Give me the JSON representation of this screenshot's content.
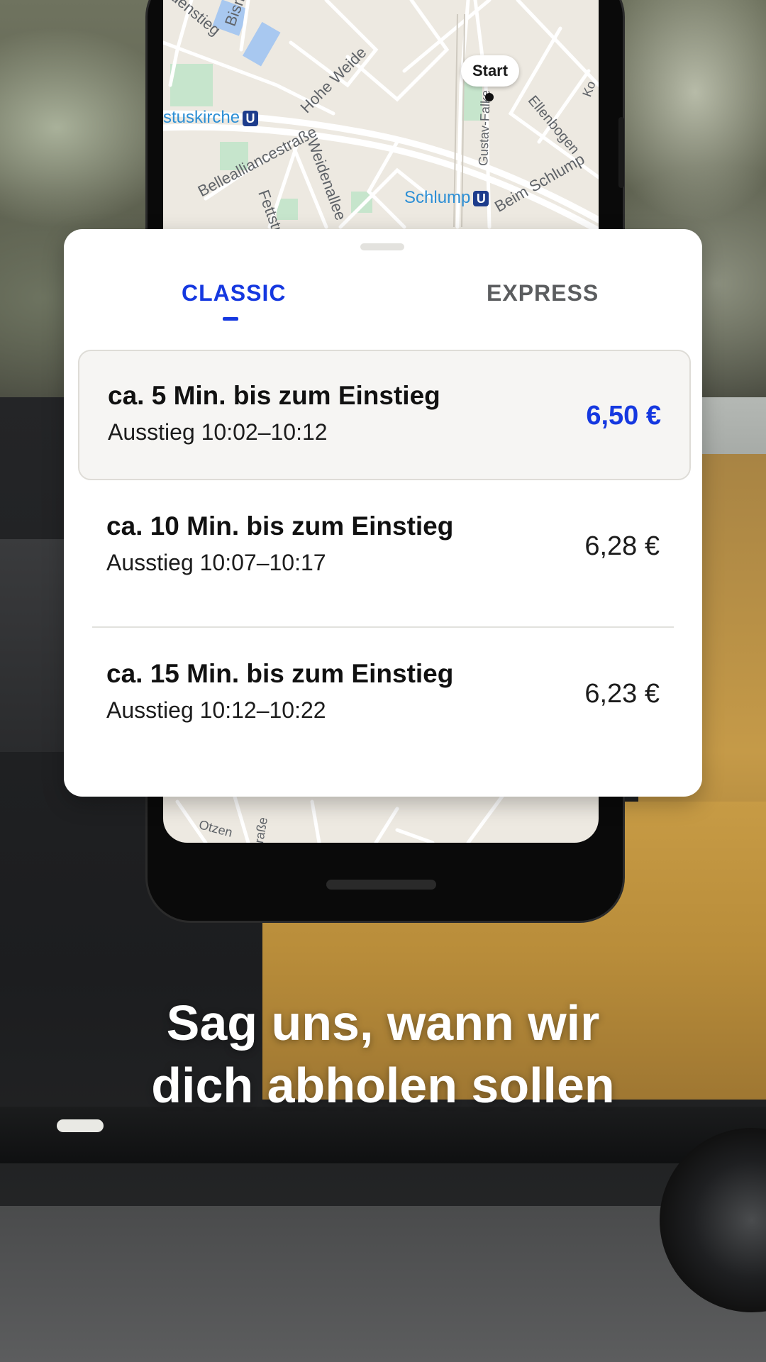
{
  "map": {
    "labels": {
      "bismarck": "Bism",
      "denstieg": "denstieg",
      "hohe_weide": "Hohe Weide",
      "church": "stuskirche",
      "bellealliance": "Bellealliancestraße",
      "weidenallee": "Weidenallee",
      "fettstr": "Fettstr",
      "schlump": "Schlump",
      "beim_schlump": "Beim Schlump",
      "gustav": "Gustav-Falke",
      "ellenbogen": "Ellenbogen",
      "ko": "Ko",
      "otzen": "Otzen",
      "strasse": "raße",
      "ubahn_symbol": "U"
    },
    "start_label": "Start"
  },
  "card": {
    "tabs": {
      "classic": "CLASSIC",
      "express": "EXPRESS"
    },
    "options": [
      {
        "title": "ca. 5 Min. bis zum Einstieg",
        "subtitle": "Ausstieg 10:02–10:12",
        "price": "6,50 €",
        "selected": true
      },
      {
        "title": "ca. 10 Min. bis zum Einstieg",
        "subtitle": "Ausstieg 10:07–10:17",
        "price": "6,28 €",
        "selected": false
      },
      {
        "title": "ca. 15 Min. bis zum Einstieg",
        "subtitle": "Ausstieg 10:12–10:22",
        "price": "6,23 €",
        "selected": false
      }
    ]
  },
  "headline": {
    "line1": "Sag uns, wann wir",
    "line2": "dich abholen sollen"
  },
  "colors": {
    "accent": "#1538e0",
    "map_bg": "#ede9e1",
    "park_green": "#c6e5cc",
    "water_blue": "#a8c8f0",
    "ubahn_blue": "#1d3c8c"
  }
}
